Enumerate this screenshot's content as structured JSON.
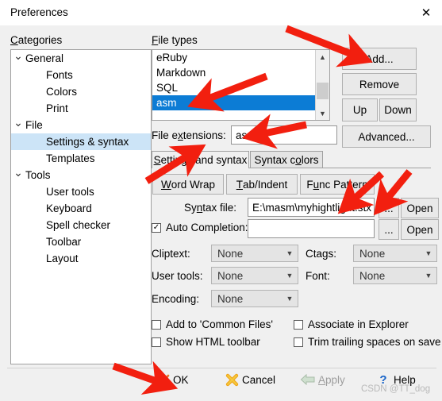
{
  "window": {
    "title": "Preferences",
    "close_icon": "close-icon"
  },
  "categories": {
    "label": "Categories",
    "label_accel": "C",
    "items": [
      {
        "label": "General",
        "level": 0,
        "expanded": true,
        "selected": false
      },
      {
        "label": "Fonts",
        "level": 1,
        "expanded": false,
        "selected": false
      },
      {
        "label": "Colors",
        "level": 1,
        "expanded": false,
        "selected": false
      },
      {
        "label": "Print",
        "level": 1,
        "expanded": false,
        "selected": false
      },
      {
        "label": "File",
        "level": 0,
        "expanded": true,
        "selected": false
      },
      {
        "label": "Settings & syntax",
        "level": 1,
        "expanded": false,
        "selected": true
      },
      {
        "label": "Templates",
        "level": 1,
        "expanded": false,
        "selected": false
      },
      {
        "label": "Tools",
        "level": 0,
        "expanded": true,
        "selected": false
      },
      {
        "label": "User tools",
        "level": 1,
        "expanded": false,
        "selected": false
      },
      {
        "label": "Keyboard",
        "level": 1,
        "expanded": false,
        "selected": false
      },
      {
        "label": "Spell checker",
        "level": 1,
        "expanded": false,
        "selected": false
      },
      {
        "label": "Toolbar",
        "level": 1,
        "expanded": false,
        "selected": false
      },
      {
        "label": "Layout",
        "level": 1,
        "expanded": false,
        "selected": false
      }
    ]
  },
  "file_types": {
    "label": "File types",
    "label_accel": "F",
    "items": [
      {
        "label": "eRuby",
        "selected": false
      },
      {
        "label": "Markdown",
        "selected": false
      },
      {
        "label": "SQL",
        "selected": false
      },
      {
        "label": "asm",
        "selected": true
      }
    ],
    "selection_color": "#0c7cd5",
    "buttons": {
      "add": "Add...",
      "add_accel": "d",
      "remove": "Remove",
      "remove_accel": "R",
      "up": "Up",
      "down": "Down",
      "advanced": "Advanced..."
    }
  },
  "file_extensions": {
    "label": "File extensions:",
    "label_accel": "x",
    "value": "asm"
  },
  "tabs": [
    {
      "label": "Settings and syntax",
      "accel": "S",
      "active": true
    },
    {
      "label": "Syntax colors",
      "accel": "o",
      "active": false
    }
  ],
  "sub_buttons": [
    {
      "label": "Word Wrap",
      "accel": "W"
    },
    {
      "label": "Tab/Indent",
      "accel": "T"
    },
    {
      "label": "Func Pattern",
      "accel": "u"
    }
  ],
  "syntax_file": {
    "label": "Syntax file:",
    "label_accel": "n",
    "value": "E:\\masm\\myhightlight.stx",
    "browse_label": "...",
    "open_label": "Open"
  },
  "auto_completion": {
    "label": "Auto Completion:",
    "checked": true,
    "value": "",
    "browse_label": "...",
    "open_label": "Open"
  },
  "selectors": {
    "cliptext": {
      "label": "Cliptext:",
      "value": "None"
    },
    "user_tools": {
      "label": "User tools:",
      "value": "None"
    },
    "encoding": {
      "label": "Encoding:",
      "value": "None"
    },
    "ctags": {
      "label": "Ctags:",
      "value": "None"
    },
    "font": {
      "label": "Font:",
      "value": "None"
    }
  },
  "checkboxes": [
    {
      "label": "Add to 'Common Files'",
      "checked": false
    },
    {
      "label": "Show HTML toolbar",
      "checked": false
    },
    {
      "label": "Associate in Explorer",
      "checked": false
    },
    {
      "label": "Trim trailing spaces on save",
      "checked": false
    }
  ],
  "footer": {
    "ok": {
      "label": "OK",
      "icon": "check-icon",
      "enabled": true
    },
    "cancel": {
      "label": "Cancel",
      "icon": "cross-icon",
      "enabled": true
    },
    "apply": {
      "label": "Apply",
      "accel": "A",
      "icon": "arrow-left-icon",
      "enabled": false
    },
    "help": {
      "label": "Help",
      "icon": "question-icon",
      "enabled": true
    },
    "watermark": "CSDN @TT_dog"
  },
  "annotations": {
    "arrow_color": "#f21f0f",
    "count": 6
  }
}
